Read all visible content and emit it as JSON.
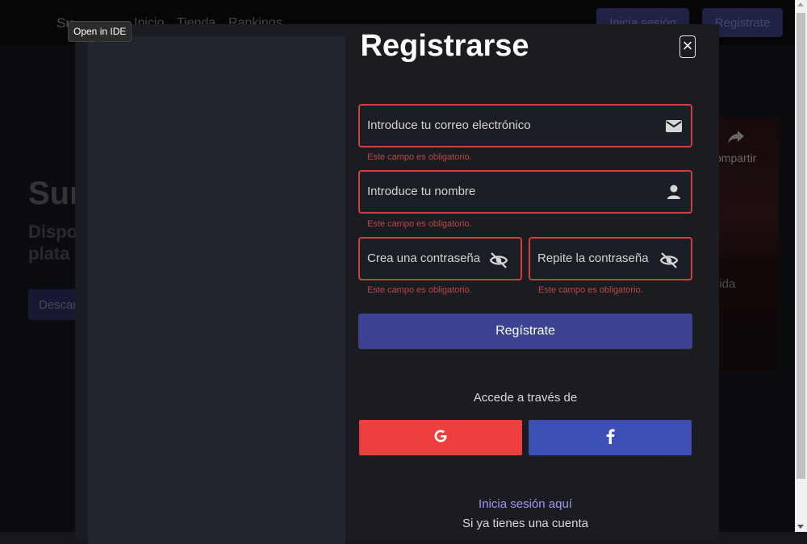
{
  "nav": {
    "brand": "Su",
    "links": [
      "Inicio",
      "Tienda",
      "Rankings"
    ],
    "login_label": "Inicia sesión",
    "register_label": "Registrate"
  },
  "hero": {
    "title": "Sur",
    "subtitle_line1": "Dispo",
    "subtitle_line2": "plata",
    "download_label": "Descar"
  },
  "video": {
    "share_label": "ompartir",
    "caption": "lida"
  },
  "tooltip": {
    "label": "Open in IDE"
  },
  "modal": {
    "close_label": "×",
    "title": "Registrarse",
    "email": {
      "placeholder": "Introduce tu correo electrónico",
      "icon": "mail-icon",
      "error": "Este campo es obligatorio."
    },
    "name": {
      "placeholder": "Introduce tu nombre",
      "icon": "user-icon",
      "error": "Este campo es obligatorio."
    },
    "password": {
      "placeholder": "Crea una contraseña",
      "icon": "eye-off-icon",
      "error": "Este campo es obligatorio."
    },
    "repeat_password": {
      "placeholder": "Repite la contraseña",
      "icon": "eye-off-icon",
      "error": "Este campo es obligatorio."
    },
    "submit_label": "Regístrate",
    "alt_access_text": "Accede a través de",
    "google_icon": "google-icon",
    "facebook_icon": "facebook-icon",
    "login_link": "Inicia sesión aquí",
    "login_hint": "Si ya tienes una cuenta"
  },
  "colors": {
    "error_border": "#d04040",
    "primary": "#3d4290",
    "google": "#ef3e3e",
    "facebook": "#3d4fb5"
  }
}
